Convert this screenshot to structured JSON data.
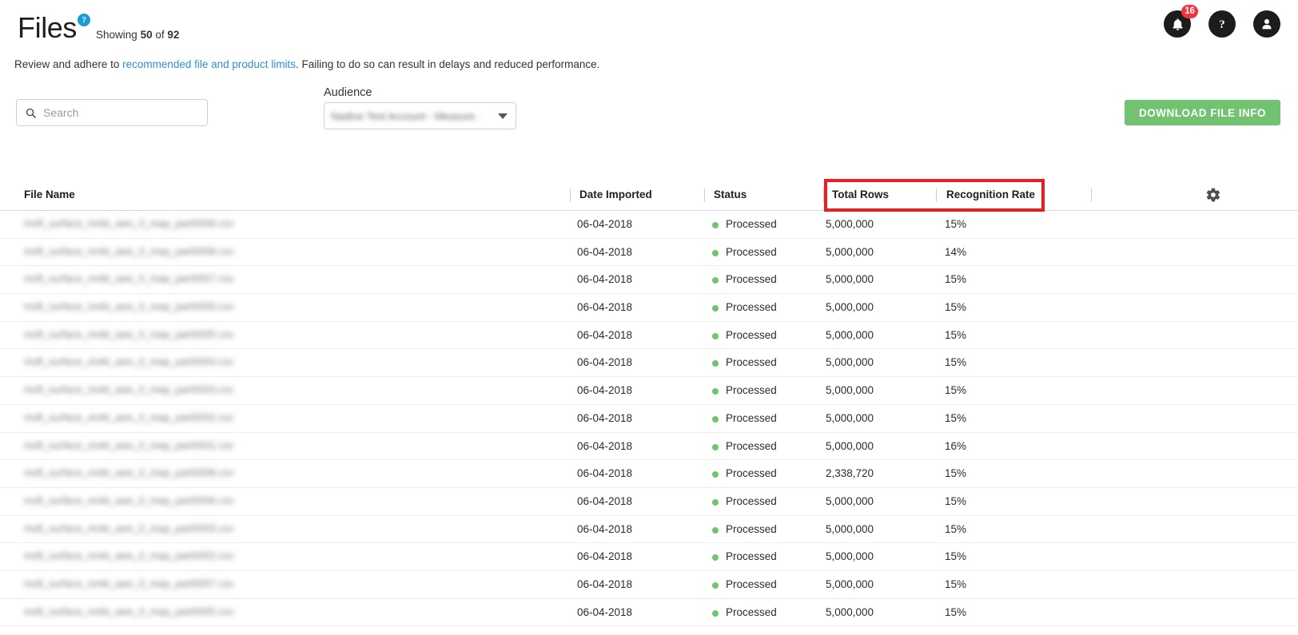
{
  "header": {
    "title": "Files",
    "help_badge": "?",
    "showing_prefix": "Showing",
    "showing_count": "50",
    "showing_middle": "of",
    "showing_total": "92",
    "subtitle_before": "Review and adhere to ",
    "subtitle_link": "recommended file and product limits",
    "subtitle_after": ". Failing to do so can result in delays and reduced performance.",
    "notifications_count": "16"
  },
  "icons": {
    "bell": "bell-icon",
    "help": "question-mark-icon",
    "account": "user-avatar-icon",
    "search": "search-icon",
    "gear": "gear-icon",
    "caret": "chevron-down-icon"
  },
  "controls": {
    "search_placeholder": "Search",
    "search_value": "",
    "audience_label": "Audience",
    "audience_value": "Nadine Test Account - Measure .",
    "download_label": "DOWNLOAD FILE INFO"
  },
  "table": {
    "columns": [
      "File Name",
      "Date Imported",
      "Status",
      "Total Rows",
      "Recognition Rate"
    ],
    "rows": [
      {
        "file": "msft_surface_mnkt_aws_0_map_part0009.csv",
        "date": "06-04-2018",
        "status": "Processed",
        "total_rows": "5,000,000",
        "rate": "15%"
      },
      {
        "file": "msft_surface_mnkt_aws_0_map_part0008.csv",
        "date": "06-04-2018",
        "status": "Processed",
        "total_rows": "5,000,000",
        "rate": "14%"
      },
      {
        "file": "msft_surface_mnkt_aws_0_map_part0007.csv",
        "date": "06-04-2018",
        "status": "Processed",
        "total_rows": "5,000,000",
        "rate": "15%"
      },
      {
        "file": "msft_surface_mnkt_aws_0_map_part0006.csv",
        "date": "06-04-2018",
        "status": "Processed",
        "total_rows": "5,000,000",
        "rate": "15%"
      },
      {
        "file": "msft_surface_mnkt_aws_0_map_part0005.csv",
        "date": "06-04-2018",
        "status": "Processed",
        "total_rows": "5,000,000",
        "rate": "15%"
      },
      {
        "file": "msft_surface_mnkt_aws_0_map_part0004.csv",
        "date": "06-04-2018",
        "status": "Processed",
        "total_rows": "5,000,000",
        "rate": "15%"
      },
      {
        "file": "msft_surface_mnkt_aws_0_map_part0003.csv",
        "date": "06-04-2018",
        "status": "Processed",
        "total_rows": "5,000,000",
        "rate": "15%"
      },
      {
        "file": "msft_surface_mnkt_aws_0_map_part0002.csv",
        "date": "06-04-2018",
        "status": "Processed",
        "total_rows": "5,000,000",
        "rate": "15%"
      },
      {
        "file": "msft_surface_mnkt_aws_0_map_part0001.csv",
        "date": "06-04-2018",
        "status": "Processed",
        "total_rows": "5,000,000",
        "rate": "16%"
      },
      {
        "file": "msft_surface_mnkt_aws_0_map_part0008.csv",
        "date": "06-04-2018",
        "status": "Processed",
        "total_rows": "2,338,720",
        "rate": "15%"
      },
      {
        "file": "msft_surface_mnkt_aws_0_map_part0006.csv",
        "date": "06-04-2018",
        "status": "Processed",
        "total_rows": "5,000,000",
        "rate": "15%"
      },
      {
        "file": "msft_surface_mnkt_aws_0_map_part0003.csv",
        "date": "06-04-2018",
        "status": "Processed",
        "total_rows": "5,000,000",
        "rate": "15%"
      },
      {
        "file": "msft_surface_mnkt_aws_0_map_part0002.csv",
        "date": "06-04-2018",
        "status": "Processed",
        "total_rows": "5,000,000",
        "rate": "15%"
      },
      {
        "file": "msft_surface_mnkt_aws_0_map_part0007.csv",
        "date": "06-04-2018",
        "status": "Processed",
        "total_rows": "5,000,000",
        "rate": "15%"
      },
      {
        "file": "msft_surface_mnkt_aws_0_map_part0005.csv",
        "date": "06-04-2018",
        "status": "Processed",
        "total_rows": "5,000,000",
        "rate": "15%"
      }
    ]
  },
  "annotation": {
    "highlight_color": "#ee1c1c",
    "highlight_target": "Total Rows / Recognition Rate column headers"
  },
  "colors": {
    "accent_green": "#71c271",
    "link_blue": "#2e8fd4",
    "badge_red": "#f5333f",
    "help_blue": "#1c9ad6",
    "status_green": "#6ec56e"
  }
}
